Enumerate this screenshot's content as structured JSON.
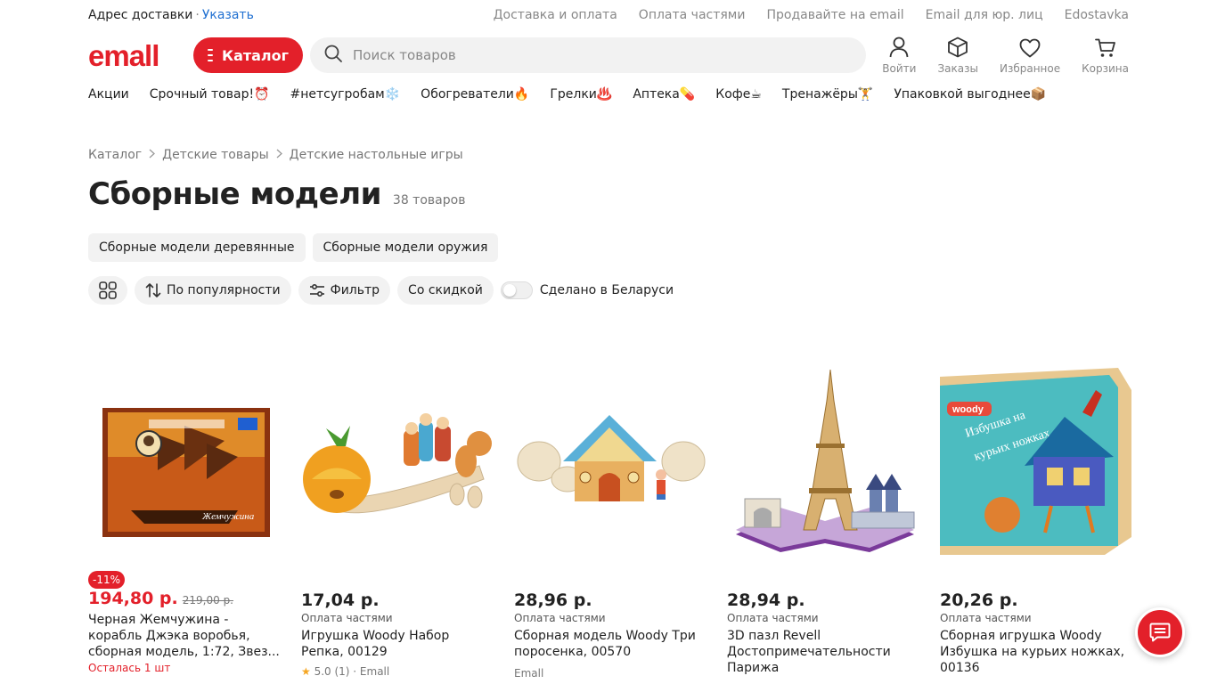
{
  "topbar": {
    "address_label": "Адрес доставки",
    "address_separator": "·",
    "address_link": "Указать",
    "links": [
      "Доставка и оплата",
      "Оплата частями",
      "Продавайте на email",
      "Email для юр. лиц",
      "Edostavka"
    ]
  },
  "header": {
    "logo_text": "emall",
    "catalog_label": "Каталог",
    "search_placeholder": "Поиск товаров",
    "icons": [
      {
        "label": "Войти",
        "icon": "user-icon"
      },
      {
        "label": "Заказы",
        "icon": "box-icon"
      },
      {
        "label": "Избранное",
        "icon": "heart-icon"
      },
      {
        "label": "Корзина",
        "icon": "cart-icon"
      }
    ]
  },
  "promo_nav": [
    "Акции",
    "Срочный товар!⏰",
    "#нетсугробам❄️",
    "Обогреватели🔥",
    "Грелки♨️",
    "Аптека💊",
    "Кофе☕",
    "Тренажёры🏋️",
    "Упаковкой выгоднее📦"
  ],
  "breadcrumbs": [
    "Каталог",
    "Детские товары",
    "Детские настольные игры"
  ],
  "page": {
    "title": "Сборные модели",
    "count": "38 товаров"
  },
  "subcategories": [
    "Сборные модели деревянные",
    "Сборные модели оружия"
  ],
  "filters": {
    "sort_label": "По популярности",
    "filter_label": "Фильтр",
    "discount_label": "Со скидкой",
    "belarus_label": "Сделано в Беларуси"
  },
  "products": [
    {
      "badge": "-11%",
      "price": "194,80 р.",
      "old_price": "219,00 р.",
      "installment": "",
      "name": "Черная Жемчужина - корабль Джэка воробья, сборная модель, 1:72, Звез...",
      "stock": "Осталась 1 шт",
      "rating": "",
      "seller": ""
    },
    {
      "badge": "",
      "price": "17,04 р.",
      "old_price": "",
      "installment": "Оплата частями",
      "name": "Игрушка Woody Набор Репка, 00129",
      "stock": "",
      "rating": "5.0 (1) · Emall",
      "seller": ""
    },
    {
      "badge": "",
      "price": "28,96 р.",
      "old_price": "",
      "installment": "Оплата частями",
      "name": "Сборная модель Woody Три поросенка, 00570",
      "stock": "",
      "rating": "",
      "seller": "Emall"
    },
    {
      "badge": "",
      "price": "28,94 р.",
      "old_price": "",
      "installment": "Оплата частями",
      "name": "3D пазл Revell Достопримечательности Парижа",
      "stock": "",
      "rating": "",
      "seller": ""
    },
    {
      "badge": "",
      "price": "20,26 р.",
      "old_price": "",
      "installment": "Оплата частями",
      "name": "Сборная игрушка Woody Избушка на курьих ножках, 00136",
      "stock": "",
      "rating": "",
      "seller": ""
    }
  ],
  "colors": {
    "accent": "#e3202a",
    "link": "#1f6fd1"
  }
}
